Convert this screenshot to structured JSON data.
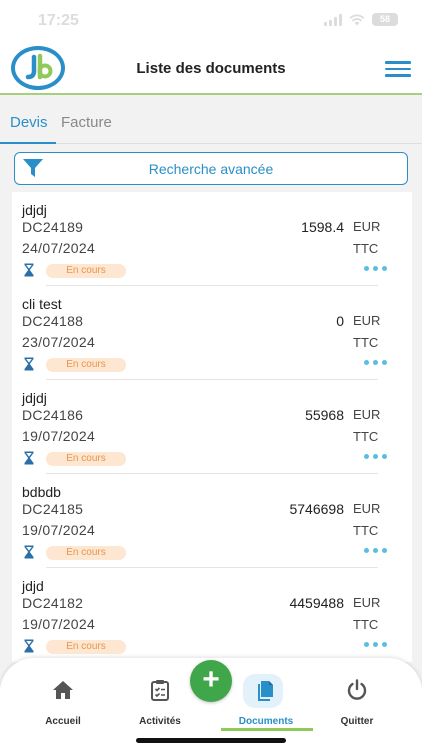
{
  "status_bar": {
    "time": "17:25",
    "battery": "58"
  },
  "header": {
    "title": "Liste des documents"
  },
  "tabs": [
    {
      "label": "Devis",
      "active": true
    },
    {
      "label": "Facture",
      "active": false
    }
  ],
  "search": {
    "label": "Recherche avancée"
  },
  "documents": [
    {
      "client": "jdjdj",
      "number": "DC24189",
      "date": "24/07/2024",
      "amount": "1598.4",
      "currency": "EUR",
      "tax": "TTC",
      "status": "En cours"
    },
    {
      "client": "cli test",
      "number": "DC24188",
      "date": "23/07/2024",
      "amount": "0",
      "currency": "EUR",
      "tax": "TTC",
      "status": "En cours"
    },
    {
      "client": "jdjdj",
      "number": "DC24186",
      "date": "19/07/2024",
      "amount": "55968",
      "currency": "EUR",
      "tax": "TTC",
      "status": "En cours"
    },
    {
      "client": "bdbdb",
      "number": "DC24185",
      "date": "19/07/2024",
      "amount": "5746698",
      "currency": "EUR",
      "tax": "TTC",
      "status": "En cours"
    },
    {
      "client": "jdjd",
      "number": "DC24182",
      "date": "19/07/2024",
      "amount": "4459488",
      "currency": "EUR",
      "tax": "TTC",
      "status": "En cours"
    }
  ],
  "fab": {
    "label": "+"
  },
  "bottom_nav": [
    {
      "label": "Accueil",
      "icon": "home-icon"
    },
    {
      "label": "Activités",
      "icon": "clipboard-icon"
    },
    {
      "label": "Documents",
      "icon": "documents-icon",
      "active": true
    },
    {
      "label": "Quitter",
      "icon": "power-icon"
    }
  ],
  "colors": {
    "accent": "#2a8fc8",
    "green": "#3fa64a",
    "badge_bg": "#fde6d2",
    "badge_text": "#e9954a",
    "dots": "#5cbde0"
  }
}
